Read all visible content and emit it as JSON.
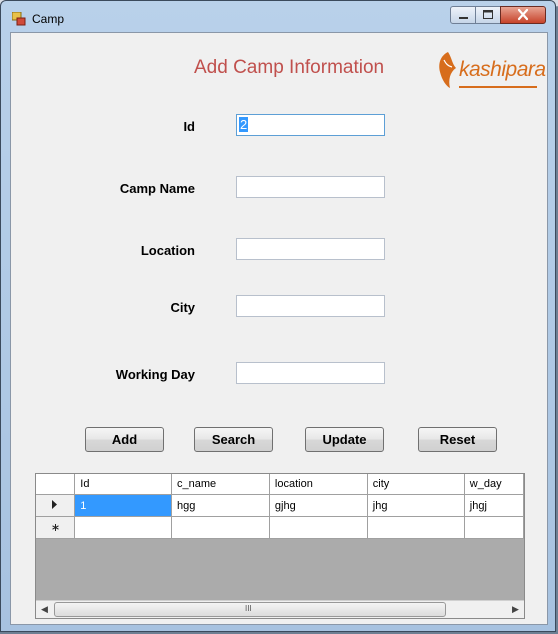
{
  "window": {
    "title": "Camp"
  },
  "form": {
    "heading": "Add Camp Information",
    "logo_text": "kashipara",
    "fields": [
      {
        "label": "Id",
        "value": "2",
        "placeholder": ""
      },
      {
        "label": "Camp Name",
        "value": "",
        "placeholder": ""
      },
      {
        "label": "Location",
        "value": "",
        "placeholder": ""
      },
      {
        "label": "City",
        "value": "",
        "placeholder": ""
      },
      {
        "label": "Working Day",
        "value": "",
        "placeholder": ""
      }
    ],
    "buttons": {
      "add": "Add",
      "search": "Search",
      "update": "Update",
      "reset": "Reset"
    }
  },
  "grid": {
    "columns": [
      "Id",
      "c_name",
      "location",
      "city",
      "w_day"
    ],
    "rows": [
      [
        "1",
        "hgg",
        "gjhg",
        "jhg",
        "jhgj"
      ]
    ],
    "scroll_grip": "III"
  },
  "colors": {
    "heading": "#c0504d",
    "logo": "#d76d1c",
    "selection": "#3399ff"
  }
}
